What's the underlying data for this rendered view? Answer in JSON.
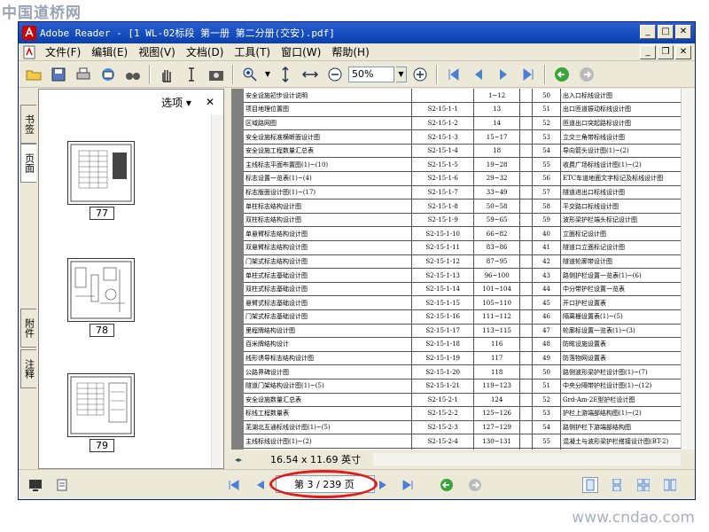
{
  "watermark": {
    "top": "中国道桥网",
    "bottom": "www.cndao.com"
  },
  "window": {
    "title": "Adobe Reader - [1 WL-02标段 第一册  第二分册(交安).pdf]"
  },
  "menu": [
    "文件(F)",
    "编辑(E)",
    "视图(V)",
    "文档(D)",
    "工具(T)",
    "窗口(W)",
    "帮助(H)"
  ],
  "toolbar": {
    "zoom": "50%"
  },
  "nav_tabs": {
    "bookmarks": "书签",
    "pages": "页面",
    "attachments": "附件",
    "comments": "注释"
  },
  "pages_panel": {
    "options_label": "选项 ▾",
    "close": "✕",
    "thumbs": [
      "77",
      "78",
      "79"
    ]
  },
  "document": {
    "page_size": "16.54 x 11.69 英寸",
    "rows": [
      {
        "name": "安全设施初步设计说明",
        "code": "",
        "pages": "1~12",
        "no": "50",
        "name2": "出入口标线设计图"
      },
      {
        "name": "项目地理位置图",
        "code": "S2-15-1-1",
        "pages": "13",
        "no": "51",
        "name2": "出口匝道振动标线设计图"
      },
      {
        "name": "区域路网图",
        "code": "S2-15-1-2",
        "pages": "14",
        "no": "52",
        "name2": "匝道出口突起路标设计图"
      },
      {
        "name": "安全设施标准横断面设计图",
        "code": "S2-15-1-3",
        "pages": "15~17",
        "no": "53",
        "name2": "立交三角带标线设计图"
      },
      {
        "name": "安全设施工程数量汇总表",
        "code": "S2-15-1-4",
        "pages": "18",
        "no": "54",
        "name2": "导向箭头设计图(1)~(2)"
      },
      {
        "name": "主线标志平面布置图(1)~(10)",
        "code": "S2-15-1-5",
        "pages": "19~28",
        "no": "55",
        "name2": "收费广场标线设计图(1)~(2)"
      },
      {
        "name": "标志设置一览表(1)~(4)",
        "code": "S2-15-1-6",
        "pages": "29~32",
        "no": "56",
        "name2": "ETC车道地面文字标记及标线设计图"
      },
      {
        "name": "标志版面设计图(1)~(17)",
        "code": "S2-15-1-7",
        "pages": "33~49",
        "no": "57",
        "name2": "隧道进出口标线设计图"
      },
      {
        "name": "单柱标志结构设计图",
        "code": "S2-15-1-8",
        "pages": "50~58",
        "no": "58",
        "name2": "平交路口标线设计图"
      },
      {
        "name": "双柱标志结构设计图",
        "code": "S2-15-1-9",
        "pages": "59~65",
        "no": "59",
        "name2": "波形梁护栏端头标记设计图"
      },
      {
        "name": "单悬臂标志结构设计图",
        "code": "S2-15-1-10",
        "pages": "66~82",
        "no": "40",
        "name2": "立面标记设计图"
      },
      {
        "name": "双悬臂标志结构设计图",
        "code": "S2-15-1-11",
        "pages": "83~86",
        "no": "41",
        "name2": "隧道口立面标记设计图"
      },
      {
        "name": "门架式标志结构设计图",
        "code": "S2-15-1-12",
        "pages": "87~95",
        "no": "42",
        "name2": "隧道轮廓带设计图"
      },
      {
        "name": "单柱式标志基础设计图",
        "code": "S2-15-1-13",
        "pages": "96~100",
        "no": "43",
        "name2": "路侧护栏设置一览表(1)~(6)"
      },
      {
        "name": "双柱式标志基础设计图",
        "code": "S2-15-1-14",
        "pages": "101~104",
        "no": "44",
        "name2": "中分带护栏设置一览表"
      },
      {
        "name": "悬臂式标志基础设计图",
        "code": "S2-15-1-15",
        "pages": "105~110",
        "no": "45",
        "name2": "开口护栏设置表"
      },
      {
        "name": "门架式标志基础设计图",
        "code": "S2-15-1-16",
        "pages": "111~112",
        "no": "46",
        "name2": "隔离栅设置表(1)~(5)"
      },
      {
        "name": "里程牌结构设计图",
        "code": "S2-15-1-17",
        "pages": "113~115",
        "no": "47",
        "name2": "轮廓标设置一览表(1)~(3)"
      },
      {
        "name": "百米牌结构设计",
        "code": "S2-15-1-18",
        "pages": "116",
        "no": "48",
        "name2": "防眩设施设置表"
      },
      {
        "name": "线形诱导标志结构设计图",
        "code": "S2-15-1-19",
        "pages": "117",
        "no": "49",
        "name2": "防落物网设置表"
      },
      {
        "name": "公路界碑设计图",
        "code": "S2-15-1-20",
        "pages": "118",
        "no": "50",
        "name2": "路侧波形梁护栏设计图(1)~(7)"
      },
      {
        "name": "隧道门架结构设计图(1)~(5)",
        "code": "S2-15-1-21",
        "pages": "119~123",
        "no": "51",
        "name2": "中央分隔带护栏设计图(1)~(12)"
      },
      {
        "name": "安全设施数量汇总表",
        "code": "S2-15-2-1",
        "pages": "124",
        "no": "52",
        "name2": "Grd-Am-2E型护栏设计图"
      },
      {
        "name": "标线工程数量表",
        "code": "S2-15-2-2",
        "pages": "125~126",
        "no": "53",
        "name2": "护栏上游端部结构图(1)~(2)"
      },
      {
        "name": "芜湖北互通标线设计图(1)~(5)",
        "code": "S2-15-2-3",
        "pages": "127~129",
        "no": "54",
        "name2": "路侧护栏下游端部结构图"
      },
      {
        "name": "主线标线设计图(1)~(2)",
        "code": "S2-15-2-4",
        "pages": "130~131",
        "no": "55",
        "name2": "混凝土与波形梁护栏搭接设计图(BT-2)"
      },
      {
        "name": "平交路口标线设计图",
        "code": "S2-15-2-5",
        "pages": "132",
        "no": "56",
        "name2": "警栏设计图(1)~(2)"
      }
    ]
  },
  "statusbar": {
    "page_indicator": "第 3 / 239 页"
  }
}
